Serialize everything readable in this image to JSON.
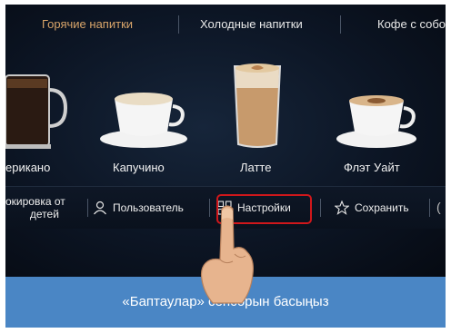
{
  "tabs": [
    {
      "label": "Горячие напитки",
      "active": true
    },
    {
      "label": "Холодные напитки",
      "active": false
    },
    {
      "label": "Кофе с собо",
      "active": false
    }
  ],
  "drinks": [
    {
      "label": "ерикано",
      "icon": "americano-glass-icon"
    },
    {
      "label": "Капучино",
      "icon": "cappuccino-cup-icon"
    },
    {
      "label": "Латте",
      "icon": "latte-glass-icon"
    },
    {
      "label": "Флэт Уайт",
      "icon": "flat-white-cup-icon"
    }
  ],
  "bottom_bar": {
    "child_lock_line1": "окировка от",
    "child_lock_line2": "детей",
    "user_label": "Пользователь",
    "settings_label": "Настройки",
    "save_label": "Сохранить"
  },
  "caption": "«Баптаулар» сенсорын басыңыз",
  "colors": {
    "active_tab": "#d9a56a",
    "highlight": "#d0171b",
    "caption_band": "#4a86c5"
  }
}
